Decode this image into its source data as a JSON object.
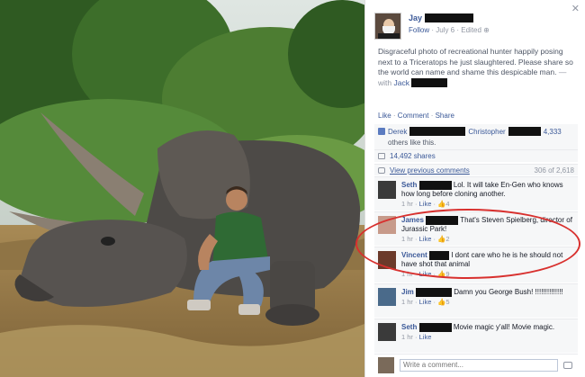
{
  "post": {
    "author": "Jay",
    "follow": "Follow",
    "date": "July 6",
    "edited": "Edited",
    "text": "Disgraceful photo of recreational hunter happily posing next to a Triceratops he just slaughtered. Please share so the world can name and shame this despicable man.",
    "with_label": "— with",
    "with_name": "Jack",
    "actions": {
      "like": "Like",
      "comment": "Comment",
      "share": "Share",
      "sep": " · "
    }
  },
  "likes": {
    "name1": "Derek",
    "name2": "Christopher",
    "count": "4,333",
    "suffix": "others like this."
  },
  "shares": "14,492 shares",
  "comments_nav": {
    "view_previous": "View previous comments",
    "count": "306 of 2,618"
  },
  "comments": [
    {
      "name": "Seth",
      "text": "Lol. It will take En-Gen who knows how long before cloning another.",
      "time": "1 hr",
      "like": "Like",
      "likes": "4",
      "avatar_color": "#3a3a3a"
    },
    {
      "name": "James",
      "text": "That's Steven Spielberg, director of Jurassic Park!",
      "time": "1 hr",
      "like": "Like",
      "likes": "2",
      "avatar_color": "#c79a8a"
    },
    {
      "name": "Vincent",
      "text": "I dont care who he is he should not have shot that animal",
      "time": "1 hr",
      "like": "Like",
      "likes": "9",
      "avatar_color": "#6b3a2a"
    },
    {
      "name": "Jim",
      "text": "Damn you George Bush! !!!!!!!!!!!!!!",
      "time": "1 hr",
      "like": "Like",
      "likes": "5",
      "avatar_color": "#4a6a8a"
    },
    {
      "name": "Seth",
      "text": "Movie magic y'all! Movie magic.",
      "time": "1 hr",
      "like": "Like",
      "likes": "",
      "avatar_color": "#3a3a3a"
    }
  ],
  "write_placeholder": "Write a comment...",
  "icons": {
    "close": "close-icon",
    "globe": "globe-icon",
    "thumb": "thumbs-up-icon",
    "share": "share-icon",
    "comment": "comment-icon",
    "camera": "camera-icon"
  },
  "colors": {
    "link": "#3b5998",
    "muted": "#9197a3",
    "highlight": "#d8302e"
  }
}
